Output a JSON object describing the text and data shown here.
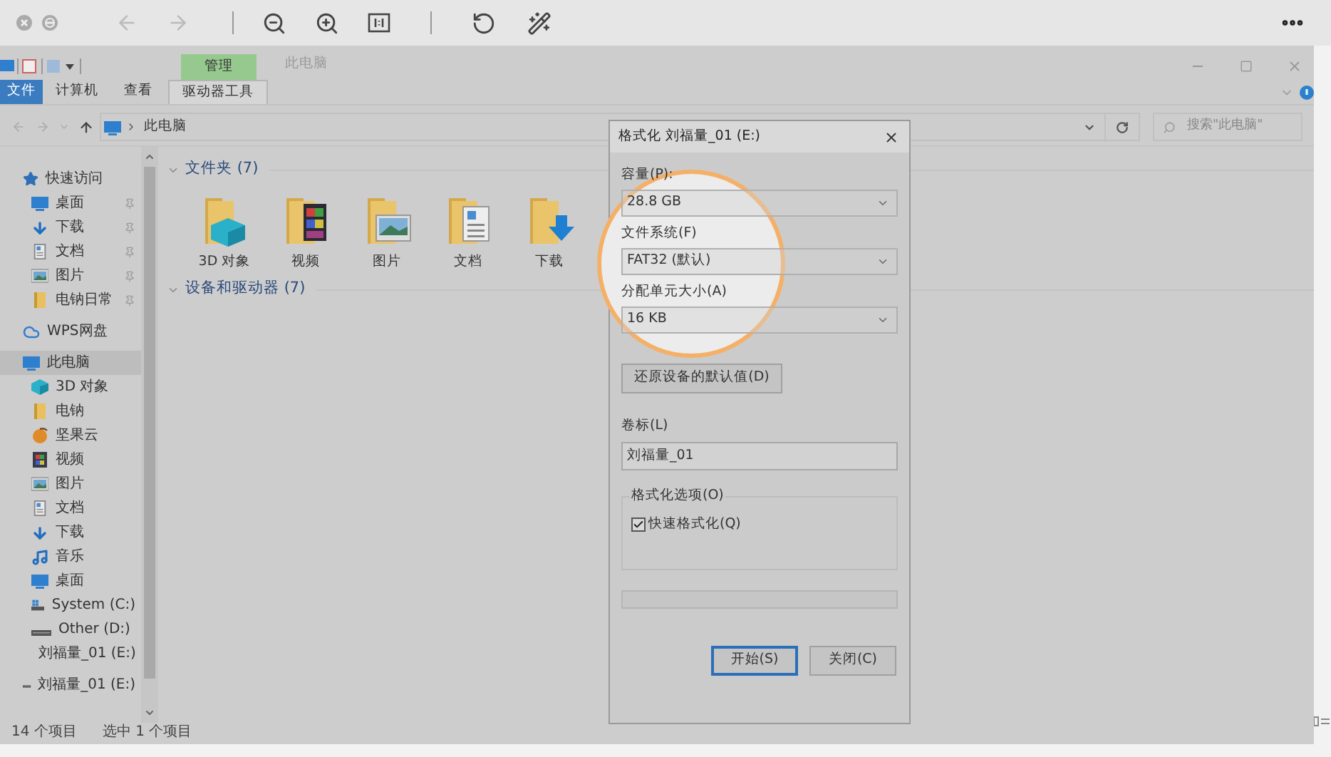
{
  "explorer": {
    "context_tab": "管理",
    "title": "此电脑",
    "ribbon_tabs": [
      {
        "label": "文件",
        "kind": "file",
        "selected": false
      },
      {
        "label": "计算机",
        "kind": "tab",
        "selected": false
      },
      {
        "label": "查看",
        "kind": "tab",
        "selected": false
      },
      {
        "label": "驱动器工具",
        "kind": "tab",
        "selected": true
      }
    ],
    "address": {
      "path": "此电脑"
    },
    "search": {
      "placeholder": "搜索\"此电脑\""
    }
  },
  "sidebar": {
    "items": [
      {
        "label": "快速访问",
        "kind": "star",
        "selected": false,
        "children": [
          {
            "label": "桌面",
            "kind": "desktop",
            "selected": false,
            "pinned": true
          },
          {
            "label": "下载",
            "kind": "download",
            "selected": false,
            "pinned": true
          },
          {
            "label": "文档",
            "kind": "document",
            "selected": false,
            "pinned": true
          },
          {
            "label": "图片",
            "kind": "picture",
            "selected": false,
            "pinned": true
          },
          {
            "label": "电钠日常",
            "kind": "folder",
            "selected": false,
            "pinned": true
          }
        ]
      },
      {
        "label": "WPS网盘",
        "kind": "cloud",
        "selected": false
      },
      {
        "label": "此电脑",
        "kind": "desktop",
        "selected": true,
        "children": [
          {
            "label": "3D 对象",
            "kind": "cube",
            "selected": false
          },
          {
            "label": "电钠",
            "kind": "folder",
            "selected": false
          },
          {
            "label": "坚果云",
            "kind": "nut",
            "selected": false
          },
          {
            "label": "视频",
            "kind": "video",
            "selected": false
          },
          {
            "label": "图片",
            "kind": "picture",
            "selected": false
          },
          {
            "label": "文档",
            "kind": "document",
            "selected": false
          },
          {
            "label": "下载",
            "kind": "download",
            "selected": false
          },
          {
            "label": "音乐",
            "kind": "music",
            "selected": false
          },
          {
            "label": "桌面",
            "kind": "desktop",
            "selected": false
          },
          {
            "label": "System (C:)",
            "kind": "system_drive",
            "selected": false
          },
          {
            "label": "Other (D:)",
            "kind": "drive",
            "selected": false
          },
          {
            "label": "刘福量_01 (E:)",
            "kind": "drive",
            "selected": false
          }
        ]
      },
      {
        "label": "刘福量_01 (E:)",
        "kind": "drive",
        "selected": false
      }
    ]
  },
  "content": {
    "groups": [
      {
        "label": "文件夹 (7)",
        "expanded": true,
        "items": [
          {
            "label": "3D 对象",
            "kind": "cube"
          },
          {
            "label": "视频",
            "kind": "video"
          },
          {
            "label": "图片",
            "kind": "picture"
          },
          {
            "label": "文档",
            "kind": "document"
          },
          {
            "label": "下载",
            "kind": "download"
          }
        ]
      },
      {
        "label": "设备和驱动器 (7)",
        "expanded": true
      }
    ]
  },
  "status_bar": {
    "item_count": "14 个项目",
    "selection": "选中 1 个项目"
  },
  "dialog": {
    "title": "格式化 刘福量_01 (E:)",
    "fields": [
      {
        "label": "容量(P):",
        "value": "28.8 GB"
      },
      {
        "label": "文件系统(F)",
        "value": "FAT32 (默认)"
      },
      {
        "label": "分配单元大小(A)",
        "value": "16 KB"
      }
    ],
    "restore_button": "还原设备的默认值(D)",
    "volume_label": {
      "label": "卷标(L)",
      "value": "刘福量_01"
    },
    "options": {
      "title": "格式化选项(O)",
      "checkboxes": [
        {
          "label": "快速格式化(Q)",
          "checked": true
        }
      ]
    },
    "progress": {
      "level": 0
    },
    "buttons": [
      {
        "label": "开始(S)",
        "focused": true
      },
      {
        "label": "关闭(C)",
        "focused": false
      }
    ]
  }
}
